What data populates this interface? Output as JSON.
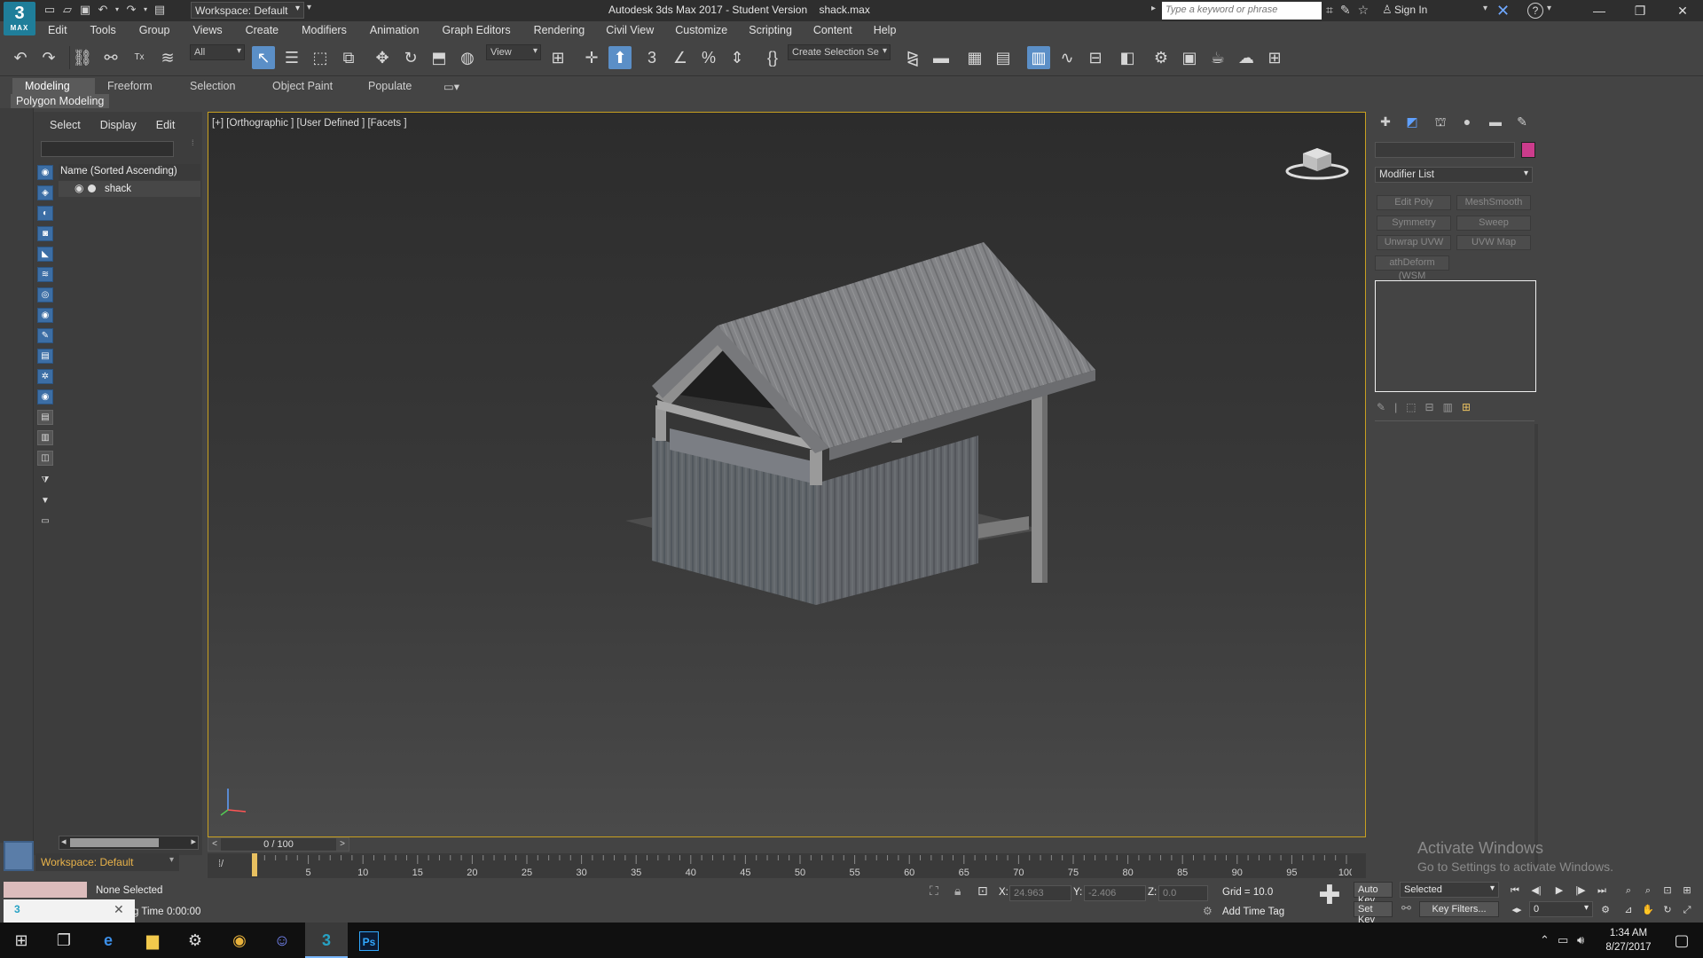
{
  "titlebar": {
    "logo_main": "3",
    "logo_sub": "MAX",
    "workspace": "Workspace: Default",
    "title": "Autodesk 3ds Max 2017 - Student Version    shack.max",
    "search_placeholder": "Type a keyword or phrase",
    "signin": "Sign In"
  },
  "menu": [
    "Edit",
    "Tools",
    "Group",
    "Views",
    "Create",
    "Modifiers",
    "Animation",
    "Graph Editors",
    "Rendering",
    "Civil View",
    "Customize",
    "Scripting",
    "Content",
    "Help"
  ],
  "toolbar": {
    "filter": "All",
    "ref_coord": "View",
    "named_selection": "Create Selection Se"
  },
  "ribbon": {
    "tabs": [
      "Modeling",
      "Freeform",
      "Selection",
      "Object Paint",
      "Populate"
    ],
    "active_tab": "Modeling",
    "panel": "Polygon Modeling"
  },
  "explorer": {
    "tabs": [
      "Select",
      "Display",
      "Edit"
    ],
    "column_header": "Name (Sorted Ascending)",
    "rows": [
      {
        "name": "shack"
      }
    ]
  },
  "viewport": {
    "label": "[+] [Orthographic ] [User Defined ] [Facets ]"
  },
  "timeline": {
    "slider": "0 / 100",
    "ticks": [
      "5",
      "10",
      "15",
      "20",
      "25",
      "30",
      "35",
      "40",
      "45",
      "50",
      "55",
      "60",
      "65",
      "70",
      "75",
      "80",
      "85",
      "90",
      "95",
      "100"
    ]
  },
  "status": {
    "selection": "None Selected",
    "time_label": "g Time",
    "time_value": "0:00:00",
    "x_label": "X:",
    "x_value": "24.963",
    "y_label": "Y:",
    "y_value": "-2.406",
    "z_label": "Z:",
    "z_value": "0.0",
    "grid": "Grid = 10.0",
    "add_time_tag": "Add Time Tag",
    "auto_key": "Auto Key",
    "set_key": "Set Key",
    "key_mode": "Selected",
    "key_filters": "Key Filters...",
    "frame": "0"
  },
  "workspace_bottom": "Workspace: Default",
  "command_panel": {
    "modifier_list": "Modifier List",
    "modifiers": [
      "Edit Poly",
      "MeshSmooth",
      "Symmetry",
      "Sweep",
      "Unwrap UVW",
      "UVW Map",
      "athDeform (WSM"
    ],
    "color": "#cc3c8c"
  },
  "activate": {
    "title": "Activate Windows",
    "subtitle": "Go to Settings to activate Windows."
  },
  "taskbar": {
    "time": "1:34 AM",
    "date": "8/27/2017",
    "ps_label": "Ps"
  }
}
